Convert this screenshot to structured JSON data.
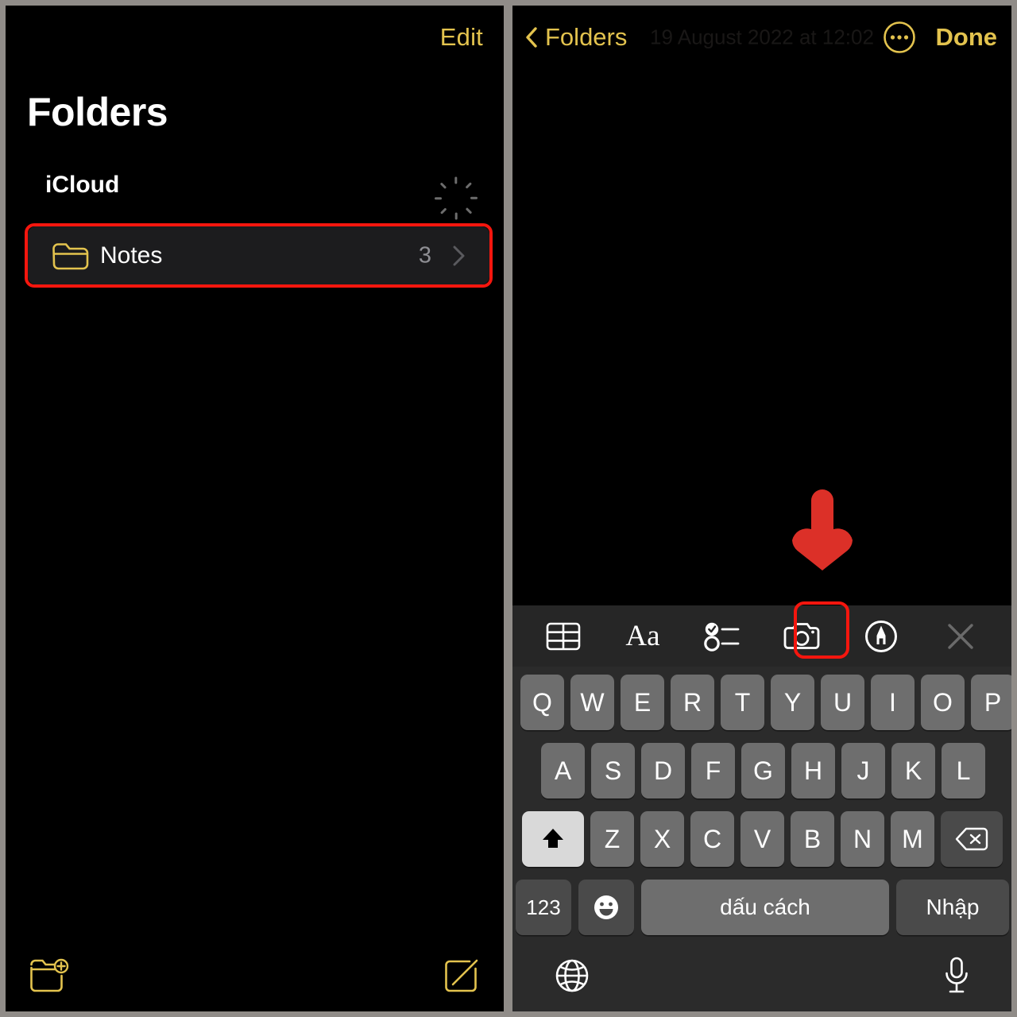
{
  "colors": {
    "accent_yellow": "#e3c34e",
    "annotation_red": "#f5160e",
    "panel_background": "#000000",
    "keyboard_background": "#2b2b2b",
    "key_fill": "#6e6e6e",
    "special_key_fill": "#4a4a4a",
    "toolbar_background": "#262626",
    "row_fill": "#1c1c1e",
    "secondary_text": "#8e8e93",
    "divider": "#908c88"
  },
  "folders_panel": {
    "nav": {
      "edit_label": "Edit"
    },
    "title": "Folders",
    "sections": [
      {
        "header": "iCloud",
        "status_icon": "sync-spinner-icon",
        "rows": [
          {
            "icon": "folder-icon",
            "label": "Notes",
            "count": "3",
            "chevron": "chevron-right-icon",
            "highlighted": true
          }
        ]
      }
    ],
    "bottom_toolbar": {
      "new_folder_icon": "new-folder-icon",
      "compose_icon": "compose-note-icon"
    }
  },
  "note_panel": {
    "nav": {
      "back_icon": "chevron-left-icon",
      "back_label": "Folders",
      "timestamp": "19 August 2022 at 12:02",
      "more_icon": "ellipsis-circle-icon",
      "done_label": "Done"
    },
    "body_text": "",
    "format_toolbar": {
      "items": [
        {
          "icon": "table-icon",
          "name": "table"
        },
        {
          "icon": "text-format-icon",
          "name": "Aa"
        },
        {
          "icon": "checklist-icon",
          "name": "checklist"
        },
        {
          "icon": "camera-icon",
          "name": "camera",
          "highlighted": true
        },
        {
          "icon": "markup-pen-icon",
          "name": "markup"
        },
        {
          "icon": "close-x-icon",
          "name": "close"
        }
      ]
    }
  },
  "keyboard": {
    "language": "Vietnamese",
    "shift_active": true,
    "rows": {
      "row1": [
        "Q",
        "W",
        "E",
        "R",
        "T",
        "Y",
        "U",
        "I",
        "O",
        "P"
      ],
      "row2": [
        "A",
        "S",
        "D",
        "F",
        "G",
        "H",
        "J",
        "K",
        "L"
      ],
      "row3_letters": [
        "Z",
        "X",
        "C",
        "V",
        "B",
        "N",
        "M"
      ]
    },
    "shift_key": "shift-up-arrow-icon",
    "backspace_key": "backspace-delete-icon",
    "numeric_key_label": "123",
    "emoji_key": "emoji-smiley-icon",
    "space_key_label": "dấu cách",
    "return_key_label": "Nhập",
    "globe_key": "globe-language-icon",
    "dictation_key": "microphone-icon"
  },
  "annotations": {
    "arrow": {
      "direction": "down",
      "points_to": "camera-button",
      "color": "#f5160e"
    }
  }
}
